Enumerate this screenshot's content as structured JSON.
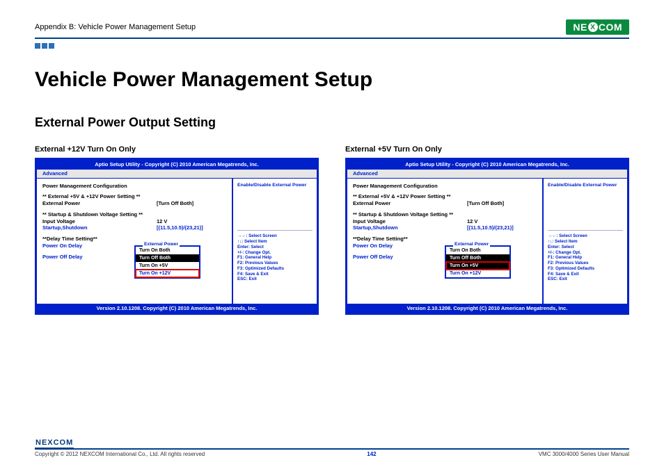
{
  "header": {
    "appendix": "Appendix B: Vehicle Power Management Setup",
    "brand_pre": "NE",
    "brand_x": "X",
    "brand_post": "COM"
  },
  "title": "Vehicle Power Management Setup",
  "subtitle": "External Power Output Setting",
  "bios_common": {
    "head": "Aptio Setup Utility - Copyright (C) 2010 American Megatrends, Inc.",
    "tab": "Advanced",
    "foot": "Version 2.10.1208. Copyright (C) 2010 American Megatrends, Inc.",
    "section1": "Power Management Configuration",
    "heading_power": "** External +5V & +12V Power Setting **",
    "ext_power_label": "External Power",
    "ext_power_value": "[Turn Off Both]",
    "heading_startup": "** Startup & Shutdown Voltage Setting **",
    "input_voltage_label": "Input Voltage",
    "input_voltage_value": "12 V",
    "startup_shutdown_label": "Startup,Shutdown",
    "startup_shutdown_value": "[(11.5,10.5)/(23,21)]",
    "heading_delay": "**Delay Time Setting**",
    "power_on_delay": "Power On Delay",
    "power_off_delay": "Power Off Delay",
    "side_title": "Enable/Disable External Power",
    "popup_title": "External Power",
    "popup_items": [
      "Turn On Both",
      "Turn Off Both",
      "Turn On +5V",
      "Turn On +12V"
    ],
    "help": {
      "l1": "→←: Select Screen",
      "l2": "↑↓: Select Item",
      "l3": "Enter: Select",
      "l4": "+/-: Change Opt.",
      "l5": "F1: General Help",
      "l6": "F2: Previous Values",
      "l7": "F3: Optimized Defaults",
      "l8": "F4: Save & Exit",
      "l9": "ESC: Exit"
    }
  },
  "panel_left": {
    "title": "External +12V Turn On Only",
    "highlight_index": 3
  },
  "panel_right": {
    "title": "External +5V Turn On Only",
    "highlight_index": 2
  },
  "footer": {
    "copyright": "Copyright © 2012 NEXCOM International Co., Ltd. All rights reserved",
    "page": "142",
    "manual": "VMC 3000/4000 Series User Manual",
    "brand": "NEXCOM"
  }
}
